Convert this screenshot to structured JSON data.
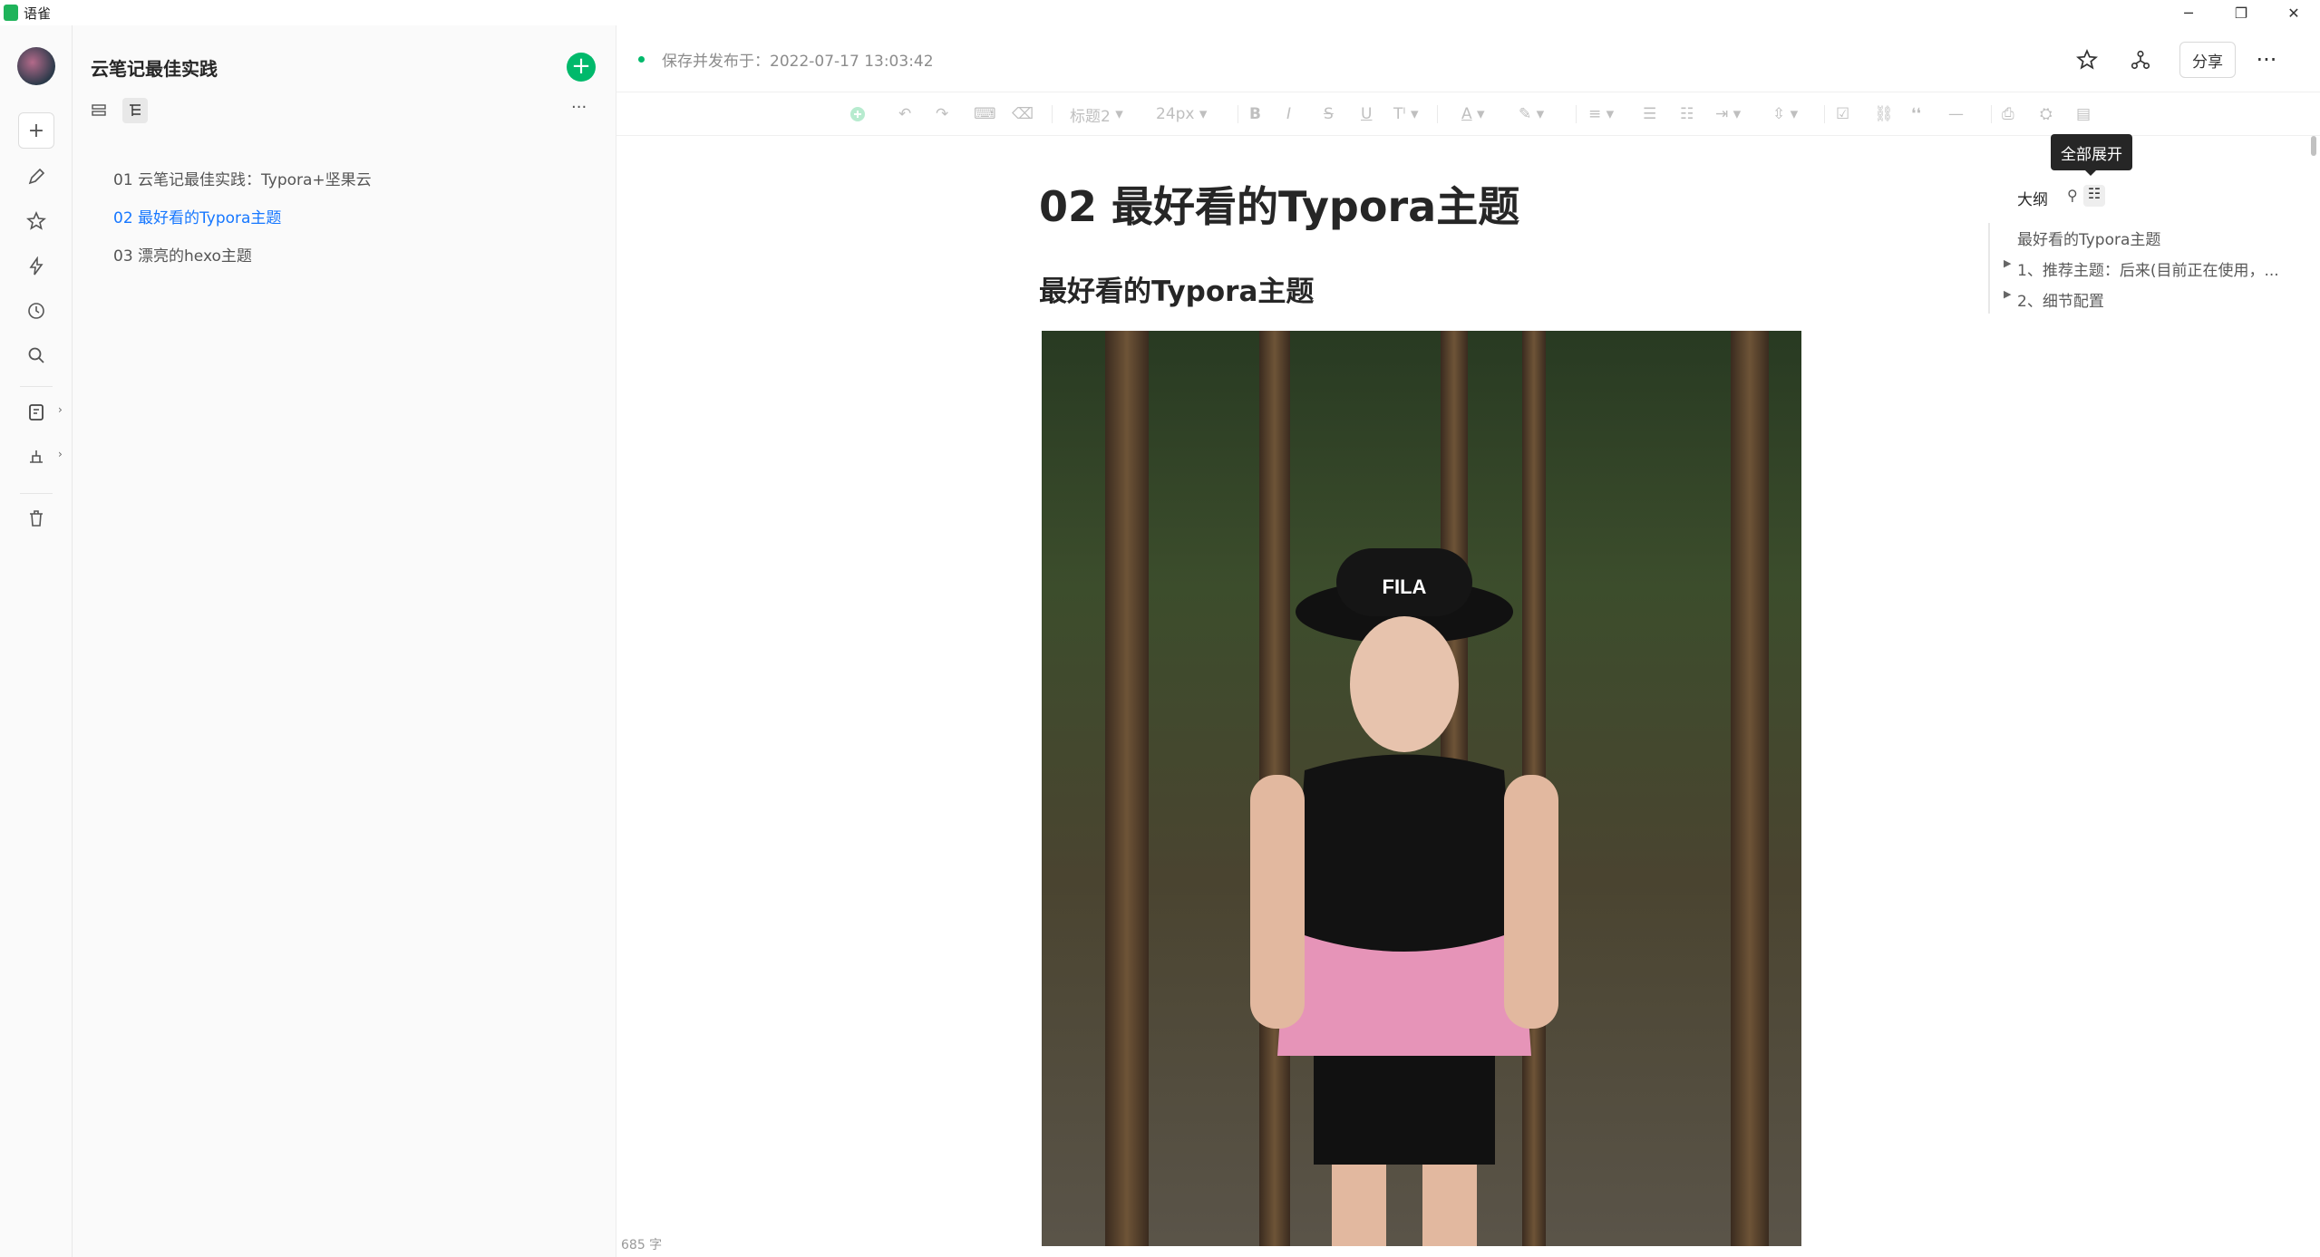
{
  "app": {
    "title": "语雀"
  },
  "window": {
    "minimize": "─",
    "maximize": "❐",
    "close": "✕"
  },
  "rail": {
    "plus": "+"
  },
  "sidebar": {
    "title": "云笔记最佳实践",
    "add": "+",
    "more": "···",
    "docs": [
      {
        "label": "01 云笔记最佳实践：Typora+坚果云",
        "active": false
      },
      {
        "label": "02 最好看的Typora主题",
        "active": true
      },
      {
        "label": "03 漂亮的hexo主题",
        "active": false
      }
    ]
  },
  "header": {
    "save_status": "保存并发布于：2022-07-17 13:03:42",
    "share": "分享",
    "more": "···"
  },
  "toolbar": {
    "heading": "标题2",
    "font_size": "24px",
    "bold": "B",
    "italic": "I",
    "strike": "S",
    "underline": "U",
    "font_color": "A",
    "quote": "❛❛",
    "hr": "—"
  },
  "document": {
    "title": "02 最好看的Typora主题",
    "h2": "最好看的Typora主题",
    "image_text": "FILA",
    "word_count": "685 字"
  },
  "outline": {
    "tooltip": "全部展开",
    "heading": "大纲",
    "items": [
      {
        "label": "最好看的Typora主题",
        "collapsible": false
      },
      {
        "label": "1、推荐主题：后来(目前正在使用，...",
        "collapsible": true
      },
      {
        "label": "2、细节配置",
        "collapsible": true
      }
    ]
  },
  "colors": {
    "accent": "#00b96b",
    "link": "#1677ff"
  }
}
